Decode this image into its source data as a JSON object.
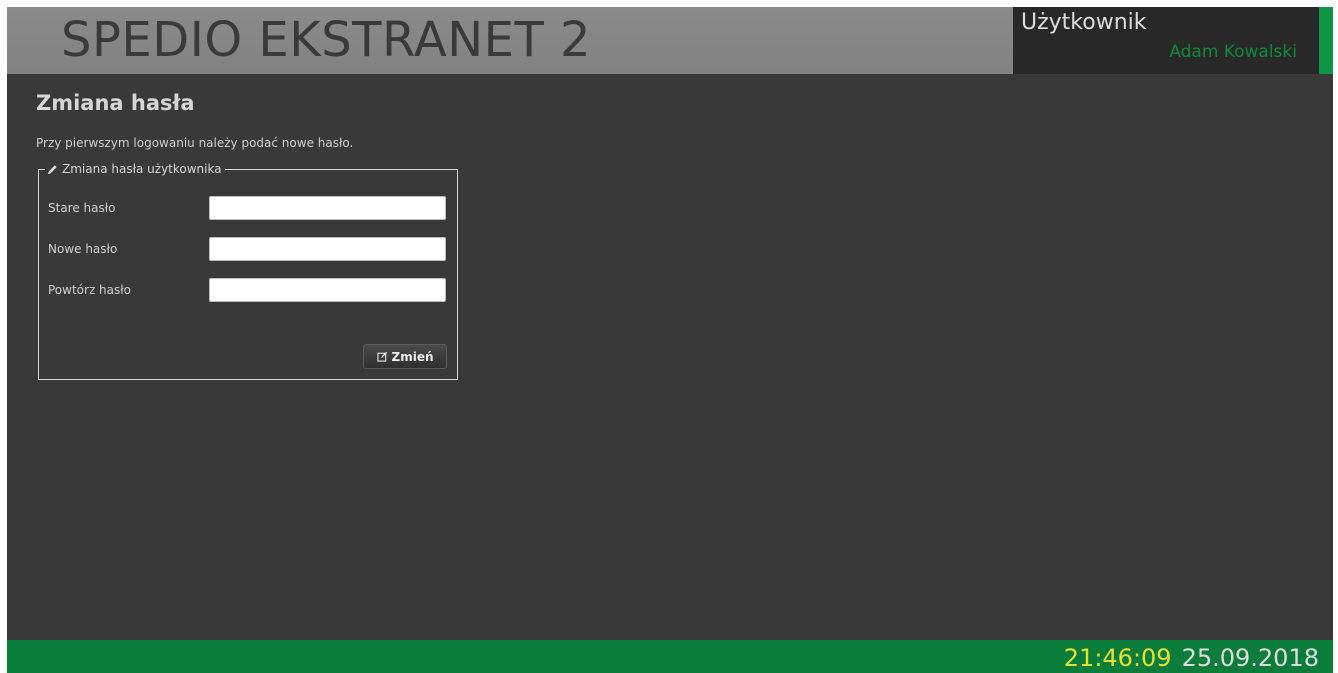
{
  "header": {
    "app_title": "SPEDIO EKSTRANET 2",
    "user_caption": "Użytkownik",
    "user_name": "Adam Kowalski"
  },
  "page": {
    "title": "Zmiana hasła",
    "intro": "Przy pierwszym logowaniu należy podać nowe hasło."
  },
  "form": {
    "legend": "Zmiana hasła użytkownika",
    "legend_icon": "pencil-icon",
    "fields": [
      {
        "label": "Stare hasło",
        "value": "",
        "placeholder": ""
      },
      {
        "label": "Nowe hasło",
        "value": "",
        "placeholder": ""
      },
      {
        "label": "Powtórz hasło",
        "value": "",
        "placeholder": ""
      }
    ],
    "submit_label": "Zmień",
    "submit_icon": "edit-icon"
  },
  "footer": {
    "time": "21:46:09",
    "date": "25.09.2018"
  },
  "colors": {
    "accent_green": "#0a7d3a",
    "user_name_green": "#0f8a3c",
    "clock_yellow": "#e6e22e",
    "background": "#393939"
  }
}
